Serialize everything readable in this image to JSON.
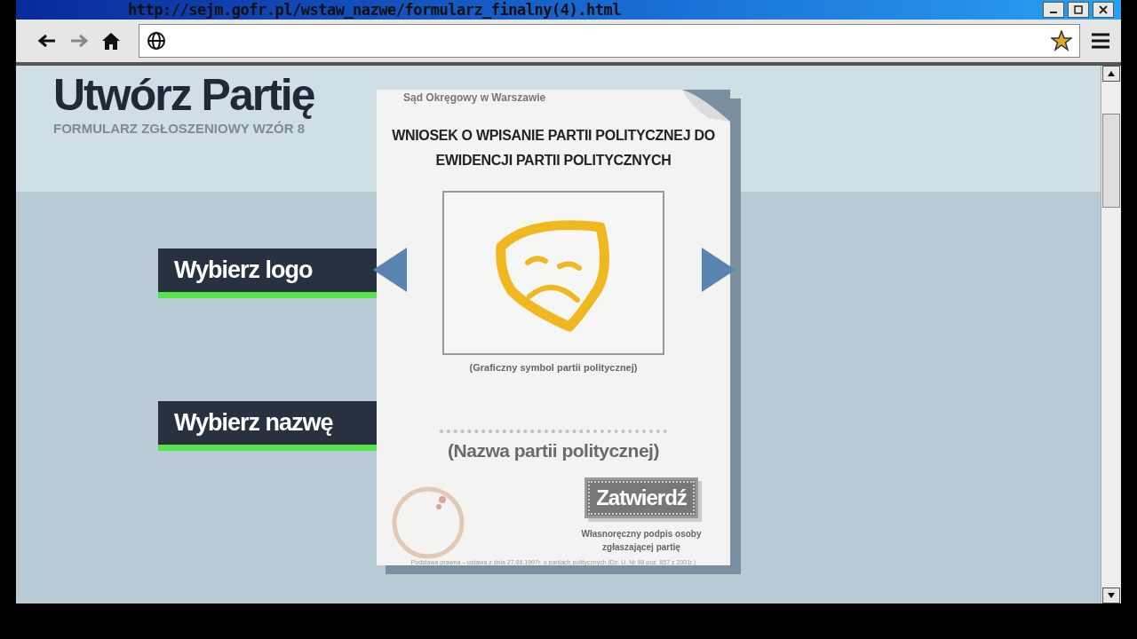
{
  "window": {
    "title": "http://sejm.gofr.pl/wstaw_nazwe/formularz_finalny(4).html"
  },
  "header": {
    "title": "Utwórz Partię",
    "subtitle": "FORMULARZ ZGŁOSZENIOWY WZÓR 8"
  },
  "menu": [
    {
      "label": "Wybierz logo"
    },
    {
      "label": "Wybierz nazwę"
    }
  ],
  "form": {
    "court": "Sąd Okręgowy w Warszawie",
    "title_lines": [
      "WNIOSEK O WPISANIE PARTII POLITYCZNEJ DO",
      "EWIDENCJI PARTII POLITYCZNYCH"
    ],
    "logo_caption": "(Graficzny symbol partii politycznej)",
    "name_placeholder": "(Nazwa partii politycznej)",
    "submit": "Zatwierdź",
    "signature_caption": "Własnoręczny podpis osoby zgłaszającej partię",
    "footnote": "Podstawa prawna – ustawa z dnia 27.06.1997r. o partiach politycznych (Dz. U. Nr 98 poz. 857 z 2001r.)"
  }
}
